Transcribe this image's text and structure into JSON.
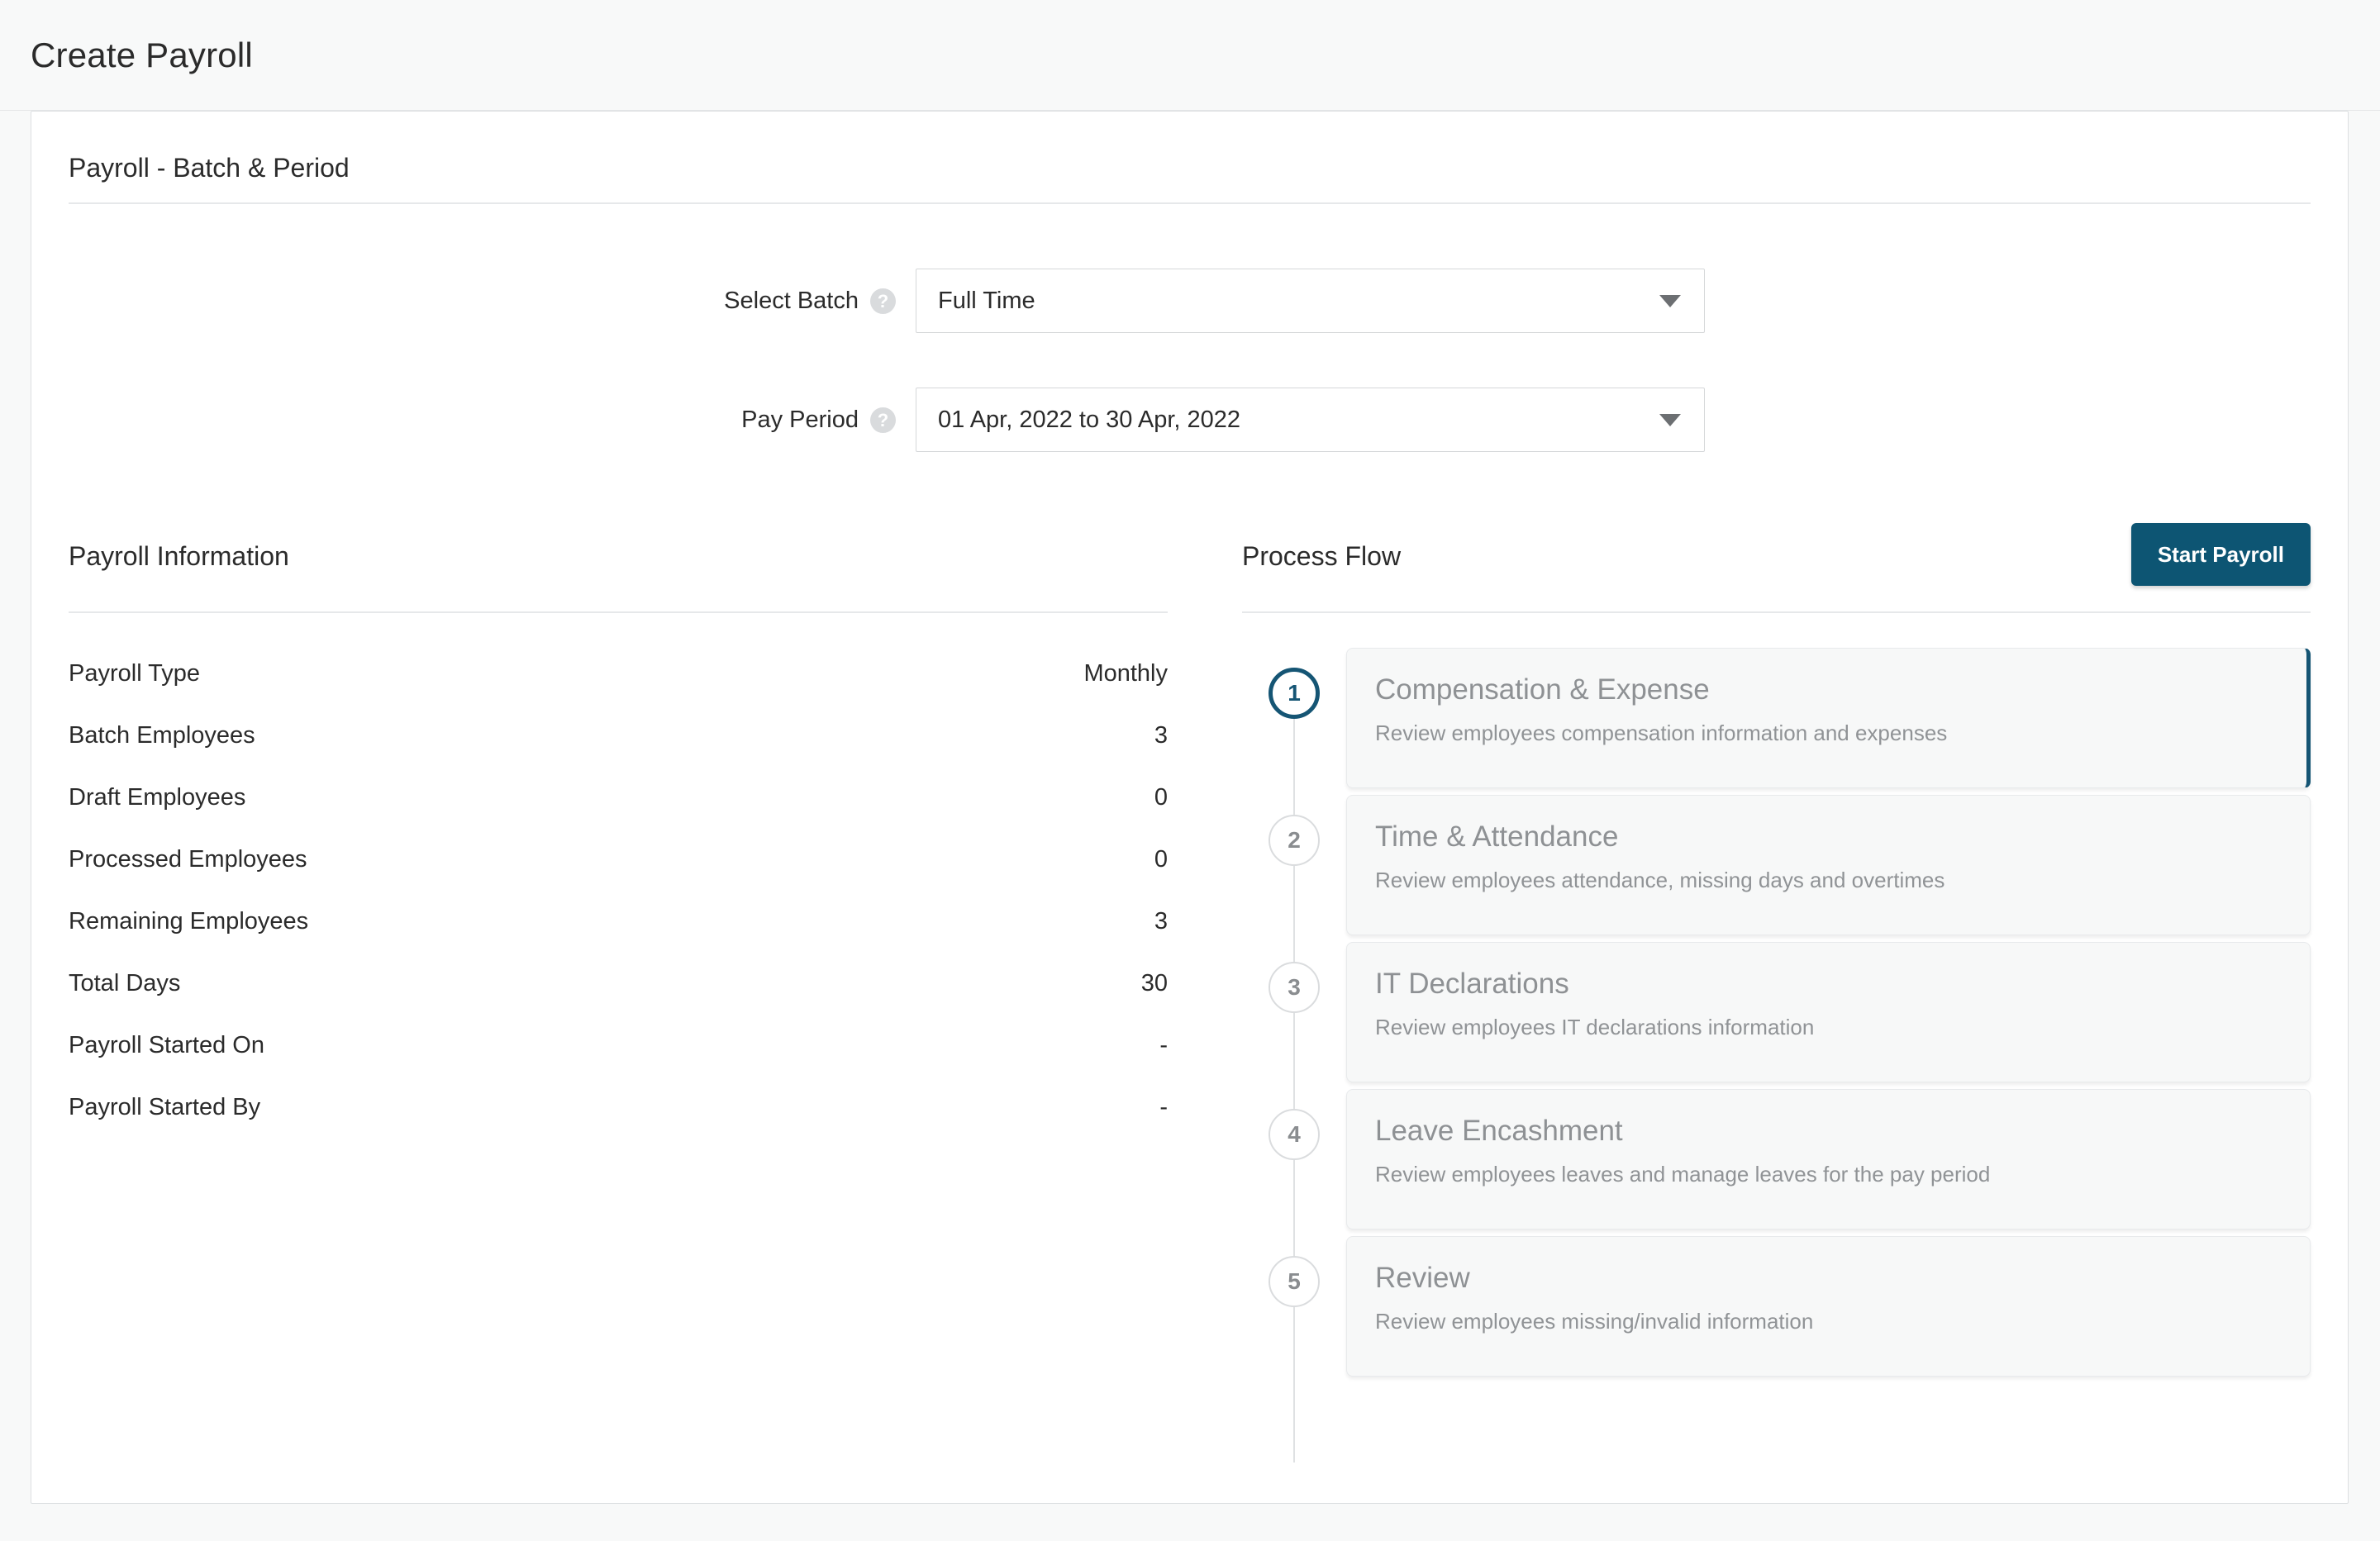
{
  "header": {
    "title": "Create Payroll"
  },
  "batch_period": {
    "section_title": "Payroll - Batch & Period",
    "fields": [
      {
        "label": "Select Batch",
        "help_icon": "help-circle-icon",
        "value": "Full Time",
        "caret_icon": "chevron-down-icon"
      },
      {
        "label": "Pay Period",
        "help_icon": "help-circle-icon",
        "value": "01 Apr, 2022 to 30 Apr, 2022",
        "caret_icon": "chevron-down-icon"
      }
    ]
  },
  "payroll_information": {
    "section_title": "Payroll Information",
    "rows": [
      {
        "key": "Payroll Type",
        "value": "Monthly"
      },
      {
        "key": "Batch Employees",
        "value": "3"
      },
      {
        "key": "Draft Employees",
        "value": "0"
      },
      {
        "key": "Processed Employees",
        "value": "0"
      },
      {
        "key": "Remaining Employees",
        "value": "3"
      },
      {
        "key": "Total Days",
        "value": "30"
      },
      {
        "key": "Payroll Started On",
        "value": "-"
      },
      {
        "key": "Payroll Started By",
        "value": "-"
      }
    ]
  },
  "process_flow": {
    "section_title": "Process Flow",
    "start_button_label": "Start Payroll",
    "accent_color": "#0d5573",
    "active_step": 1,
    "steps": [
      {
        "number": "1",
        "title": "Compensation & Expense",
        "description": "Review employees compensation information and expenses"
      },
      {
        "number": "2",
        "title": "Time & Attendance",
        "description": "Review employees attendance, missing days and overtimes"
      },
      {
        "number": "3",
        "title": "IT Declarations",
        "description": "Review employees IT declarations information"
      },
      {
        "number": "4",
        "title": "Leave Encashment",
        "description": "Review employees leaves and manage leaves for the pay period"
      },
      {
        "number": "5",
        "title": "Review",
        "description": "Review employees missing/invalid information"
      }
    ]
  }
}
